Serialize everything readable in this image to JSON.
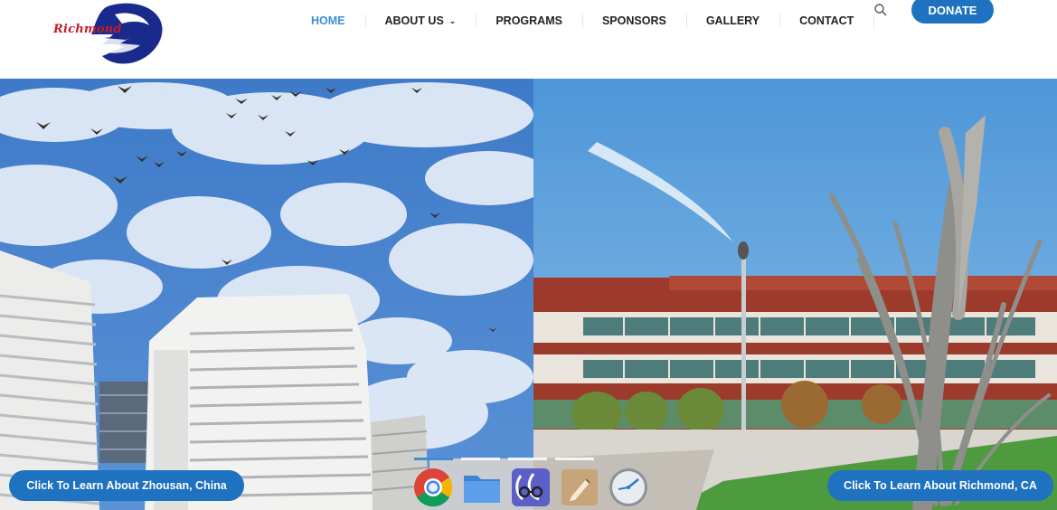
{
  "logo": {
    "text": "Richmond"
  },
  "nav": {
    "items": [
      {
        "label": "HOME",
        "active": true
      },
      {
        "label": "ABOUT US",
        "dropdown": true
      },
      {
        "label": "PROGRAMS"
      },
      {
        "label": "SPONSORS"
      },
      {
        "label": "GALLERY"
      },
      {
        "label": "CONTACT"
      }
    ],
    "caret": "⌄"
  },
  "donate": {
    "label": "DONATE"
  },
  "hero": {
    "left_cta": "Click To Learn About Zhousan, China",
    "right_cta": "Click To Learn About Richmond, CA",
    "slides": 4,
    "active_slide": 1
  },
  "dock": {
    "icons": [
      "chrome-icon",
      "files-folder-icon",
      "glasses-app-icon",
      "text-editor-icon",
      "clock-icon"
    ]
  },
  "colors": {
    "accent": "#1e72c0",
    "nav_active": "#3a8fd6",
    "logo_red": "#c0202a",
    "logo_navy": "#1a2a8c"
  }
}
